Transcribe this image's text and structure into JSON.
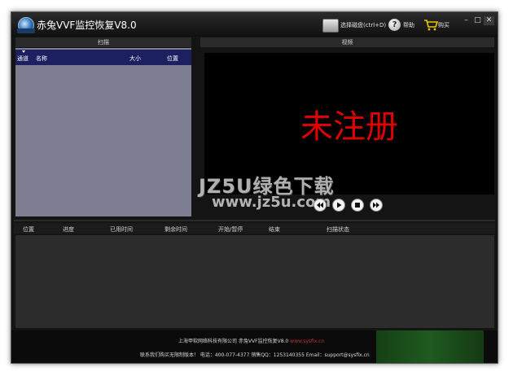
{
  "titlebar": {
    "title": "赤兔VVF监控恢复V8.0",
    "logo_text": "VVF",
    "disk_label": "选择磁盘(ctrl+D)",
    "help_label": "帮助",
    "buy_label": "购买"
  },
  "scan_panel": {
    "header": "扫描",
    "columns": [
      "通道",
      "名称",
      "大小",
      "位置"
    ]
  },
  "video_panel": {
    "header": "视频",
    "overlay_text": "未注册",
    "overlay_color": "#e00000"
  },
  "tasks": {
    "columns": [
      "位置",
      "进度",
      "已用时间",
      "剩余时间",
      "开始/暂停",
      "结束",
      "扫描状态"
    ]
  },
  "footer": {
    "line1_company": "上海甲软网络科技有限公司",
    "line1_product": "赤兔VVF监控恢复V8.0",
    "line1_site": "www.sysfix.cn",
    "line2": "联系我们购买无限制版本！ 电话：400-077-4377 销售QQ：1253140355 Email：support@sysfix.cn"
  },
  "watermark": {
    "line1": "JZ5U绿色下载",
    "line2": "www.jz5u.com"
  }
}
